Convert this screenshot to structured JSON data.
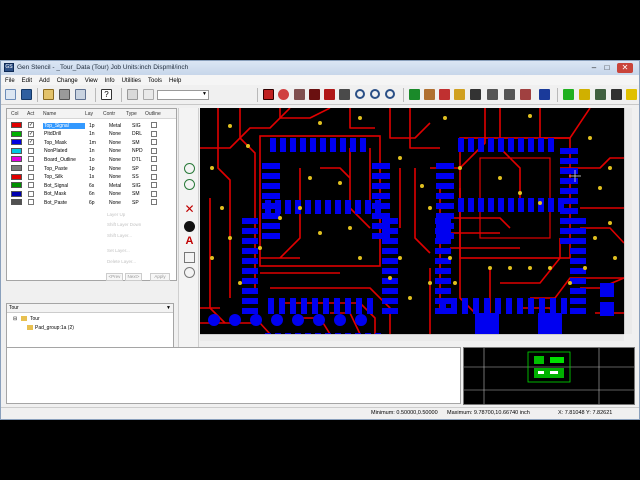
{
  "window": {
    "title": "Gen Stencil - _Tour_Data (Tour)  Job Units:inch Dispmil/inch",
    "minimize": "–",
    "maximize": "□",
    "close": "✕"
  },
  "menu": [
    "File",
    "Edit",
    "Add",
    "Change",
    "View",
    "Info",
    "Utilities",
    "Tools",
    "Help"
  ],
  "layers": {
    "headers": {
      "col": "Col",
      "act": "Act",
      "name": "Name",
      "lay": "Lay",
      "contr": "Contr",
      "type": "Type",
      "outline": "Outline"
    },
    "rows": [
      {
        "name": "Top_Signal",
        "lay": "1p",
        "contr": "Metal",
        "type": "SIG",
        "color": "#e00000",
        "act": "✓",
        "selected": true
      },
      {
        "name": "PltdDrill",
        "lay": "1n",
        "contr": "None",
        "type": "DRL",
        "color": "#00b000",
        "act": "✓",
        "selected": false
      },
      {
        "name": "Top_Mask",
        "lay": "1m",
        "contr": "None",
        "type": "SM",
        "color": "#0000e0",
        "act": "✓",
        "selected": false
      },
      {
        "name": "NonPlated",
        "lay": "1n",
        "contr": "None",
        "type": "NPD",
        "color": "#00c8e0",
        "act": "",
        "selected": false
      },
      {
        "name": "Board_Outline",
        "lay": "1o",
        "contr": "None",
        "type": "DTL",
        "color": "#e000e0",
        "act": "",
        "selected": false
      },
      {
        "name": "Top_Paste",
        "lay": "1p",
        "contr": "None",
        "type": "SP",
        "color": "#7a7a7a",
        "act": "",
        "selected": false
      },
      {
        "name": "Top_Silk",
        "lay": "1s",
        "contr": "None",
        "type": "SS",
        "color": "#e00000",
        "act": "",
        "selected": false
      },
      {
        "name": "Bot_Signal",
        "lay": "6s",
        "contr": "Metal",
        "type": "SIG",
        "color": "#009000",
        "act": "",
        "selected": false
      },
      {
        "name": "Bot_Mask",
        "lay": "6n",
        "contr": "None",
        "type": "SM",
        "color": "#0000b0",
        "act": "",
        "selected": false
      },
      {
        "name": "Bot_Paste",
        "lay": "6p",
        "contr": "None",
        "type": "SP",
        "color": "#505050",
        "act": "",
        "selected": false
      }
    ],
    "ghost_menu": [
      "Layer Up",
      "Shift Layer Down",
      "Shift Layer...",
      "Set Layer...",
      "Delete Layer..."
    ],
    "buttons": {
      "prev": "<Prev",
      "next": "Next>",
      "apply": "Apply"
    }
  },
  "tree": {
    "header": "Tour",
    "root": "Tour",
    "child": "Pad_group:1a (2)"
  },
  "status": {
    "minimum": "Minimum: 0.50000,0.50000",
    "maximum": "Maximum: 9.78700,10.66740 inch",
    "xy": "X:  7.81048  Y:  7.82621"
  },
  "colors": {
    "trace": "#e00000",
    "pad": "#0000f0",
    "drill": "#e0c020",
    "preview_board": "#00e000"
  }
}
